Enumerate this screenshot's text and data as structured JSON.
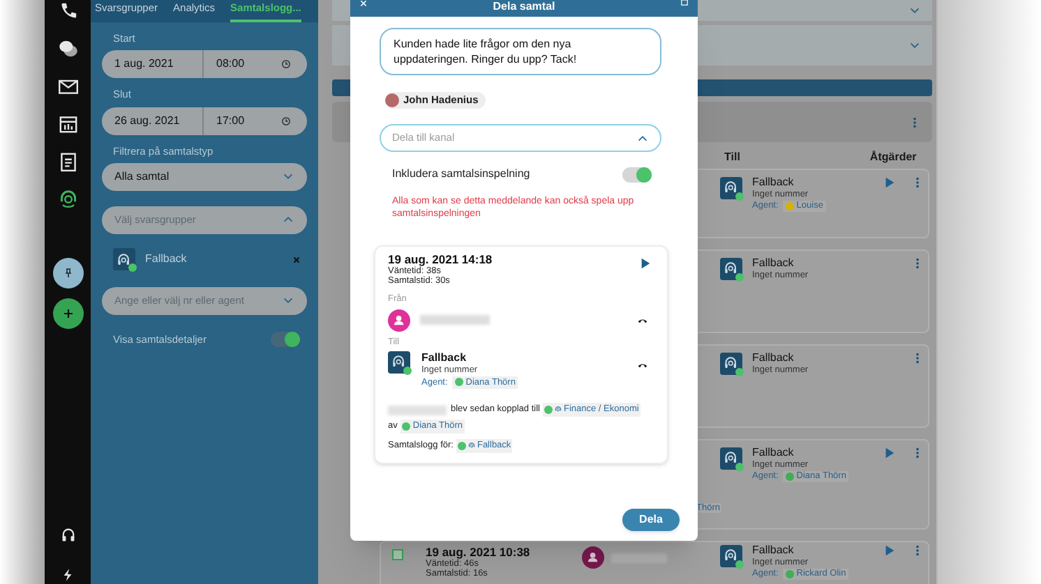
{
  "nav_rail": {
    "items": [
      {
        "selected": false
      },
      {
        "selected": false
      },
      {
        "selected": false
      },
      {
        "selected": false
      },
      {
        "selected": false
      },
      {
        "selected": true
      }
    ]
  },
  "filter_panel": {
    "tabs": [
      {
        "label": "Svarsgrupper",
        "selected": false
      },
      {
        "label": "Analytics",
        "selected": false
      },
      {
        "label": "Samtalslogg...",
        "selected": true
      }
    ],
    "start": {
      "label": "Start",
      "date": "1 aug. 2021",
      "time": "08:00"
    },
    "end": {
      "label": "Slut",
      "date": "26 aug. 2021",
      "time": "17:00"
    },
    "call_type": {
      "label": "Filtrera på samtalstyp",
      "value": "Alla samtal"
    },
    "group_select": {
      "placeholder": "Välj svarsgrupper",
      "expanded": true
    },
    "selected_groups": [
      {
        "name": "Fallback"
      }
    ],
    "agent_select": {
      "placeholder": "Ange eller välj nr eller agent",
      "expanded": false
    },
    "show_details": {
      "label": "Visa samtalsdetaljer",
      "on": true
    }
  },
  "call_log": {
    "columns": [
      "Till",
      "Åtgärder"
    ],
    "cards": [
      {
        "to_name": "Fallback",
        "to_number": "Inget nummer",
        "agent_label": "Agent:",
        "agent": {
          "name": "Louise",
          "color": "#d4b400"
        },
        "playable": true
      },
      {
        "to_name": "Fallback",
        "to_number": "Inget nummer",
        "playable": false
      },
      {
        "to_name": "Fallback",
        "to_number": "Inget nummer",
        "playable": false
      },
      {
        "to_name": "Fallback",
        "to_number": "Inget nummer",
        "agent_label": "Agent:",
        "agent": {
          "name": "Diana Thörn",
          "color": "#3fae55"
        },
        "playable": true,
        "trailing": "Thörn"
      },
      {
        "checked": false,
        "date": "19 aug. 2021 10:38",
        "wait": "Väntetid: 46s",
        "talk": "Samtalstid: 16s",
        "to_name": "Fallback",
        "to_number": "Inget nummer",
        "agent_label": "Agent:",
        "agent": {
          "name": "Rickard Olin",
          "color": "#3fae55"
        },
        "playable": true
      }
    ]
  },
  "share_dialog": {
    "title": "Dela samtal",
    "message": "Kunden hade lite frågor om den nya uppdateringen. Ringer du upp? Tack!",
    "recipients": [
      {
        "name": "John Hadenius"
      }
    ],
    "channel_select": {
      "placeholder": "Dela till kanal",
      "expanded": true
    },
    "include_recording": {
      "label": "Inkludera samtalsinspelning",
      "on": true
    },
    "warning": "Alla som kan se detta meddelande kan också spela upp samtalsinspelningen",
    "call": {
      "date": "19 aug. 2021 14:18",
      "wait": "Väntetid: 38s",
      "talk": "Samtalstid: 30s",
      "from_label": "Från",
      "to_label": "Till",
      "to": {
        "name": "Fallback",
        "number": "Inget nummer",
        "agent_label": "Agent:",
        "agent": "Diana Thörn"
      },
      "transfer_text": "blev sedan kopplad till",
      "transfer_target": "Finance / Ekonomi",
      "by_label": "av",
      "by": "Diana Thörn",
      "log_label": "Samtalslogg för:",
      "log_target": "Fallback"
    },
    "submit": "Dela"
  }
}
